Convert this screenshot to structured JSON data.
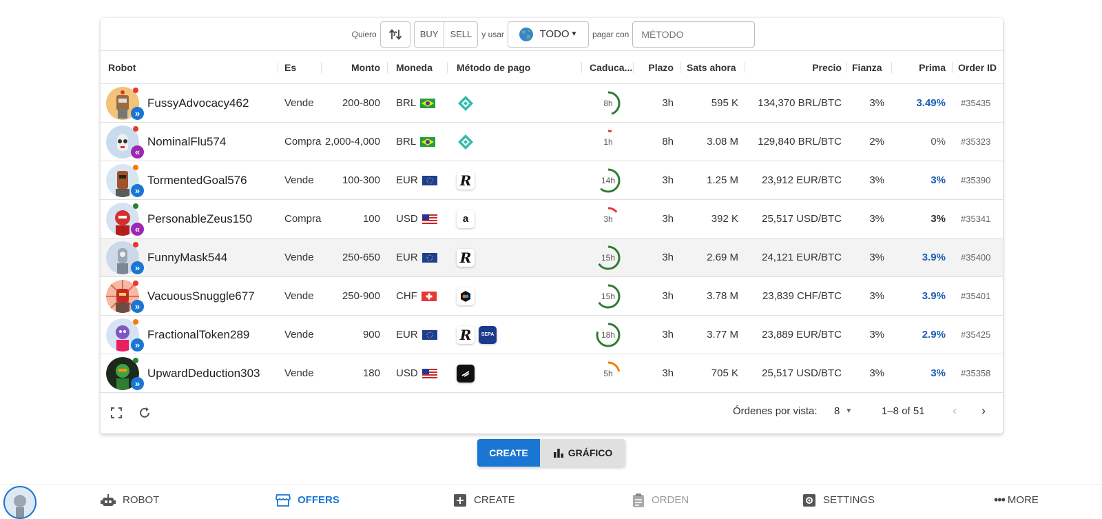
{
  "filter": {
    "quiero": "Quiero",
    "buy": "BUY",
    "sell": "SELL",
    "y_usar": "y usar",
    "currency": "TODO",
    "pagar_con": "pagar con",
    "method_placeholder": "MÉTODO"
  },
  "columns": [
    "Robot",
    "Es",
    "Monto",
    "Moneda",
    "Método de pago",
    "Caduca...",
    "Plazo",
    "Sats ahora",
    "Precio",
    "Fianza",
    "Prima",
    "Order ID"
  ],
  "rows": [
    {
      "robot": "FussyAdvocacy462",
      "es": "Vende",
      "monto": "200-800",
      "moneda": "BRL",
      "expiry": "8h",
      "plazo": "3h",
      "sats": "595 K",
      "precio": "134,370 BRL/BTC",
      "fianza": "3%",
      "prima": "3.49%",
      "order_id": "#35435"
    },
    {
      "robot": "NominalFlu574",
      "es": "Compra",
      "monto": "2,000-4,000",
      "moneda": "BRL",
      "expiry": "1h",
      "plazo": "8h",
      "sats": "3.08 M",
      "precio": "129,840 BRL/BTC",
      "fianza": "2%",
      "prima": "0%",
      "order_id": "#35323"
    },
    {
      "robot": "TormentedGoal576",
      "es": "Vende",
      "monto": "100-300",
      "moneda": "EUR",
      "expiry": "14h",
      "plazo": "3h",
      "sats": "1.25 M",
      "precio": "23,912 EUR/BTC",
      "fianza": "3%",
      "prima": "3%",
      "order_id": "#35390"
    },
    {
      "robot": "PersonableZeus150",
      "es": "Compra",
      "monto": "100",
      "moneda": "USD",
      "expiry": "3h",
      "plazo": "3h",
      "sats": "392 K",
      "precio": "25,517 USD/BTC",
      "fianza": "3%",
      "prima": "3%",
      "order_id": "#35341"
    },
    {
      "robot": "FunnyMask544",
      "es": "Vende",
      "monto": "250-650",
      "moneda": "EUR",
      "expiry": "15h",
      "plazo": "3h",
      "sats": "2.69 M",
      "precio": "24,121 EUR/BTC",
      "fianza": "3%",
      "prima": "3.9%",
      "order_id": "#35400"
    },
    {
      "robot": "VacuousSnuggle677",
      "es": "Vende",
      "monto": "250-900",
      "moneda": "CHF",
      "expiry": "15h",
      "plazo": "3h",
      "sats": "3.78 M",
      "precio": "23,839 CHF/BTC",
      "fianza": "3%",
      "prima": "3.9%",
      "order_id": "#35401"
    },
    {
      "robot": "FractionalToken289",
      "es": "Vende",
      "monto": "900",
      "moneda": "EUR",
      "expiry": "18h",
      "plazo": "3h",
      "sats": "3.77 M",
      "precio": "23,889 EUR/BTC",
      "fianza": "3%",
      "prima": "2.9%",
      "order_id": "#35425"
    },
    {
      "robot": "UpwardDeduction303",
      "es": "Vende",
      "monto": "180",
      "moneda": "USD",
      "expiry": "5h",
      "plazo": "3h",
      "sats": "705 K",
      "precio": "25,517 USD/BTC",
      "fianza": "3%",
      "prima": "3%",
      "order_id": "#35358"
    }
  ],
  "footer": {
    "rows_per_page_label": "Órdenes por vista:",
    "rows_per_page": "8",
    "range": "1–8 of 51"
  },
  "actions": {
    "create": "CREATE",
    "chart": "GRÁFICO"
  },
  "nav": {
    "robot": "ROBOT",
    "offers": "OFFERS",
    "create": "CREATE",
    "orden": "ORDEN",
    "settings": "SETTINGS",
    "more": "MORE"
  },
  "colors": {
    "accent": "#1976d2",
    "prima": "#1a5fb4",
    "sell_badge": "#1976d2",
    "buy_badge": "#9c27b0",
    "ring_green": "#2e7d32",
    "ring_red": "#e53935",
    "ring_orange": "#f57c00"
  }
}
